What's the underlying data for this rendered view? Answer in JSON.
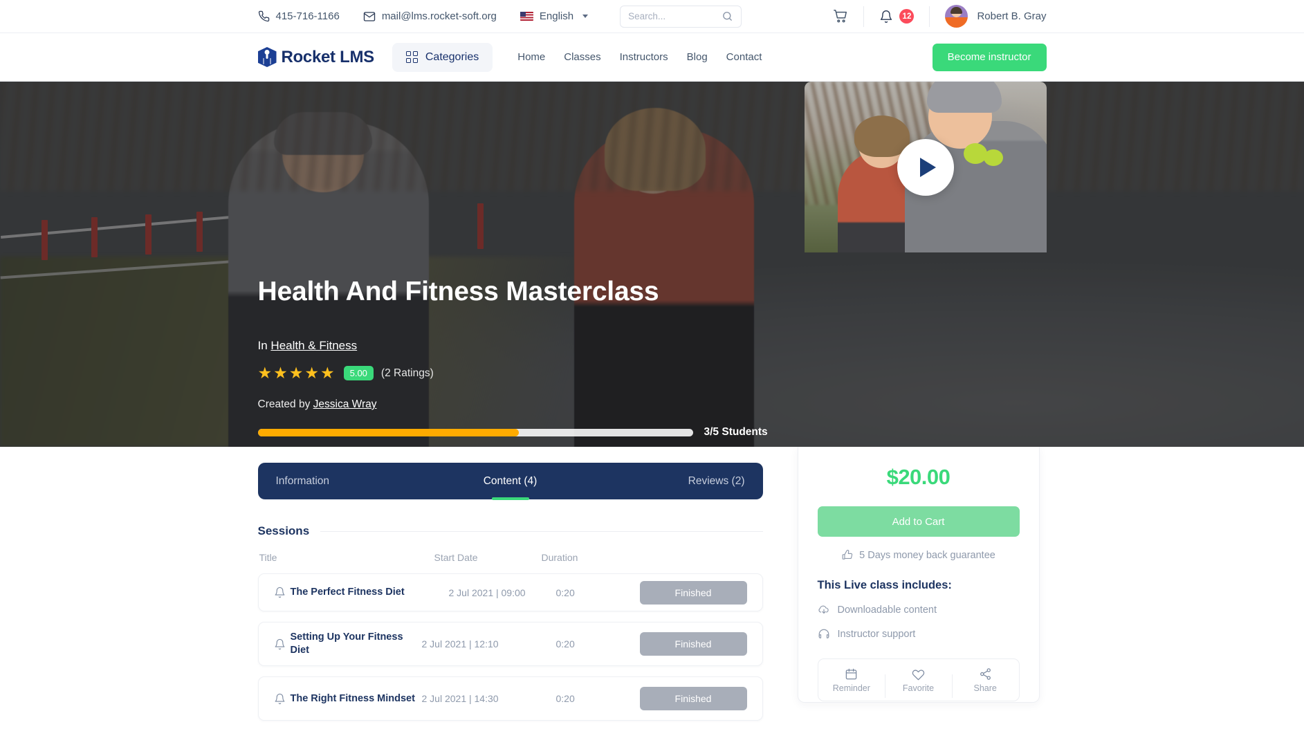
{
  "topbar": {
    "phone": "415-716-1166",
    "email": "mail@lms.rocket-soft.org",
    "language": "English",
    "search_placeholder": "Search...",
    "notification_count": "12",
    "username": "Robert B. Gray"
  },
  "nav": {
    "brand": "Rocket LMS",
    "categories_label": "Categories",
    "links": [
      {
        "label": "Home"
      },
      {
        "label": "Classes"
      },
      {
        "label": "Instructors"
      },
      {
        "label": "Blog"
      },
      {
        "label": "Contact"
      }
    ],
    "cta_label": "Become instructor"
  },
  "hero": {
    "title": "Health And Fitness Masterclass",
    "in_label": "In",
    "category": "Health & Fitness",
    "stars": "★★★★★",
    "rating_value": "5.00",
    "rating_count": "(2 Ratings)",
    "created_by_label": "Created by",
    "author": "Jessica Wray",
    "progress_percent": 60,
    "students_label": "3/5 Students"
  },
  "tabs": [
    {
      "label": "Information",
      "active": false
    },
    {
      "label": "Content (4)",
      "active": true
    },
    {
      "label": "Reviews (2)",
      "active": false
    }
  ],
  "sessions": {
    "heading": "Sessions",
    "columns": {
      "title": "Title",
      "start_date": "Start Date",
      "duration": "Duration"
    },
    "rows": [
      {
        "title": "The Perfect Fitness Diet",
        "start_date": "2 Jul 2021 | 09:00",
        "duration": "0:20",
        "status": "Finished"
      },
      {
        "title": "Setting Up Your Fitness Diet",
        "start_date": "2 Jul 2021 | 12:10",
        "duration": "0:20",
        "status": "Finished"
      },
      {
        "title": "The Right Fitness Mindset",
        "start_date": "2 Jul 2021 | 14:30",
        "duration": "0:20",
        "status": "Finished"
      }
    ]
  },
  "sidebar": {
    "price": "$20.00",
    "add_to_cart": "Add to Cart",
    "guarantee": "5 Days money back guarantee",
    "includes_title": "This Live class includes:",
    "includes": [
      {
        "label": "Downloadable content"
      },
      {
        "label": "Instructor support"
      }
    ],
    "actions": [
      {
        "label": "Reminder"
      },
      {
        "label": "Favorite"
      },
      {
        "label": "Share"
      }
    ]
  },
  "colors": {
    "brand_navy": "#1d3461",
    "accent_green": "#3ad97a",
    "progress_orange": "#ffab00",
    "badge_red": "#fc4b5b",
    "muted": "#8e99ab"
  }
}
